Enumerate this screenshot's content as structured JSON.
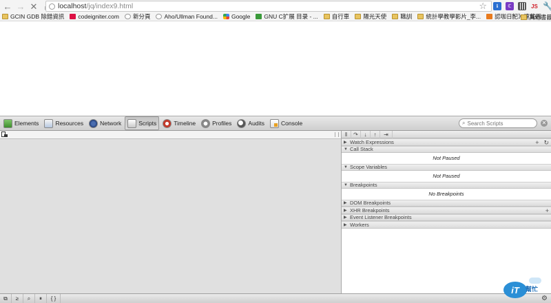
{
  "browser": {
    "url_host": "localhost",
    "url_path": "/jq/index9.html",
    "back_icon": "back-arrow-icon",
    "forward_icon": "forward-arrow-icon",
    "stop_icon": "stop-icon",
    "home_icon": "home-icon",
    "star_icon": "star-icon",
    "extensions": [
      "translate-icon",
      "extension-icon",
      "qr-icon",
      "js-icon"
    ],
    "extension_js_label": "JS"
  },
  "bookmarks": {
    "items": [
      {
        "label": "GCIN GDB 除錯資訊",
        "icon": "folder-icon"
      },
      {
        "label": "codeigniter.com",
        "icon": "red-favicon"
      },
      {
        "label": "新分頁",
        "icon": "globe-icon"
      },
      {
        "label": "Aho/Ullman Found...",
        "icon": "globe-icon"
      },
      {
        "label": "Google",
        "icon": "google-icon"
      },
      {
        "label": "GNU C扩展 目录 - ...",
        "icon": "green-favicon"
      },
      {
        "label": "自行車",
        "icon": "folder-icon"
      },
      {
        "label": "陽光天使",
        "icon": "folder-icon"
      },
      {
        "label": "職訓",
        "icon": "folder-icon"
      },
      {
        "label": "統計學教學影片_李...",
        "icon": "folder-icon"
      },
      {
        "label": "認咖日記》連載四 : ...",
        "icon": "orange-favicon"
      },
      {
        "label": "數位電子電路",
        "icon": "folder-icon"
      }
    ],
    "more": "»",
    "other": "其他書籤"
  },
  "devtools": {
    "tabs": [
      {
        "label": "Elements",
        "icon": "elements-icon",
        "active": false
      },
      {
        "label": "Resources",
        "icon": "resources-icon",
        "active": false
      },
      {
        "label": "Network",
        "icon": "network-icon",
        "active": false
      },
      {
        "label": "Scripts",
        "icon": "scripts-icon",
        "active": true
      },
      {
        "label": "Timeline",
        "icon": "timeline-icon",
        "active": false
      },
      {
        "label": "Profiles",
        "icon": "profiles-icon",
        "active": false
      },
      {
        "label": "Audits",
        "icon": "audits-icon",
        "active": false
      },
      {
        "label": "Console",
        "icon": "console-icon",
        "active": false
      }
    ],
    "search_placeholder": "Search Scripts",
    "debugger_buttons": [
      "pause",
      "step-over",
      "step-into",
      "step-out",
      "deactivate-breakpoints"
    ],
    "debugger_glyphs": [
      "‖",
      "↷",
      "↓",
      "↑",
      "⇥"
    ],
    "panes": [
      {
        "title": "Watch Expressions",
        "expanded": false,
        "body": "",
        "actions": [
          "+",
          "↻"
        ]
      },
      {
        "title": "Call Stack",
        "expanded": true,
        "body": "Not Paused",
        "actions": []
      },
      {
        "title": "Scope Variables",
        "expanded": true,
        "body": "Not Paused",
        "actions": []
      },
      {
        "title": "Breakpoints",
        "expanded": true,
        "body": "No Breakpoints",
        "actions": []
      },
      {
        "title": "DOM Breakpoints",
        "expanded": false,
        "body": "",
        "actions": []
      },
      {
        "title": "XHR Breakpoints",
        "expanded": false,
        "body": "",
        "actions": [
          "+"
        ]
      },
      {
        "title": "Event Listener Breakpoints",
        "expanded": false,
        "body": "",
        "actions": []
      },
      {
        "title": "Workers",
        "expanded": false,
        "body": "",
        "actions": []
      }
    ],
    "status_buttons": [
      "dock-icon",
      "console-toggle-icon",
      "search-icon",
      "pause-exceptions-icon",
      "pretty-print-icon"
    ],
    "status_glyphs": [
      "⧉",
      "≥",
      "⌕",
      "⏸",
      "{ }"
    ]
  },
  "watermark": {
    "text": "iT",
    "sub": "幫忙"
  }
}
